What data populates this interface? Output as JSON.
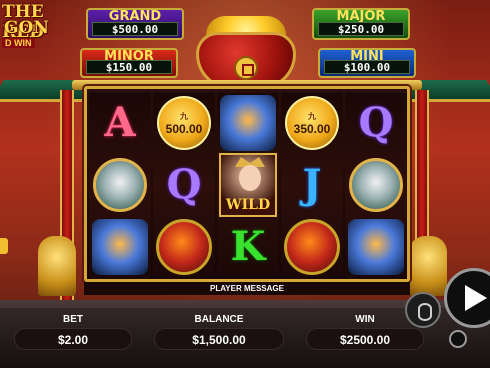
{
  "logo": {
    "line1": "THE RED",
    "line2": "GON",
    "sub": "D WIN"
  },
  "jackpots": {
    "grand": {
      "label": "GRAND",
      "value": "$500.00"
    },
    "major": {
      "label": "MAJOR",
      "value": "$250.00"
    },
    "minor": {
      "label": "MINOR",
      "value": "$150.00"
    },
    "mini": {
      "label": "MINI",
      "value": "$100.00"
    }
  },
  "reels": [
    [
      {
        "type": "letter",
        "text": "A",
        "cls": "sym-A"
      },
      {
        "type": "tiger"
      },
      {
        "type": "dragon-blue"
      }
    ],
    [
      {
        "type": "coin",
        "top": "九",
        "value": "500.00"
      },
      {
        "type": "letter",
        "text": "Q",
        "cls": "sym-Q"
      },
      {
        "type": "dragon-red"
      }
    ],
    [
      {
        "type": "dragon-blue"
      },
      {
        "type": "wild",
        "text": "WILD"
      },
      {
        "type": "letter",
        "text": "K",
        "cls": "sym-K"
      }
    ],
    [
      {
        "type": "coin",
        "top": "九",
        "value": "350.00"
      },
      {
        "type": "letter",
        "text": "J",
        "cls": "sym-J"
      },
      {
        "type": "dragon-red"
      }
    ],
    [
      {
        "type": "letter",
        "text": "Q",
        "cls": "sym-Q"
      },
      {
        "type": "tiger"
      },
      {
        "type": "dragon-blue"
      }
    ]
  ],
  "player_message": "PLAYER MESSAGE",
  "bottom": {
    "bet_label": "BET",
    "bet_value": "$2.00",
    "balance_label": "BALANCE",
    "balance_value": "$1,500.00",
    "win_label": "WIN",
    "win_value": "$2500.00"
  },
  "icons": [
    "coin-stack-icon",
    "play-icon",
    "autoplay-icon"
  ]
}
